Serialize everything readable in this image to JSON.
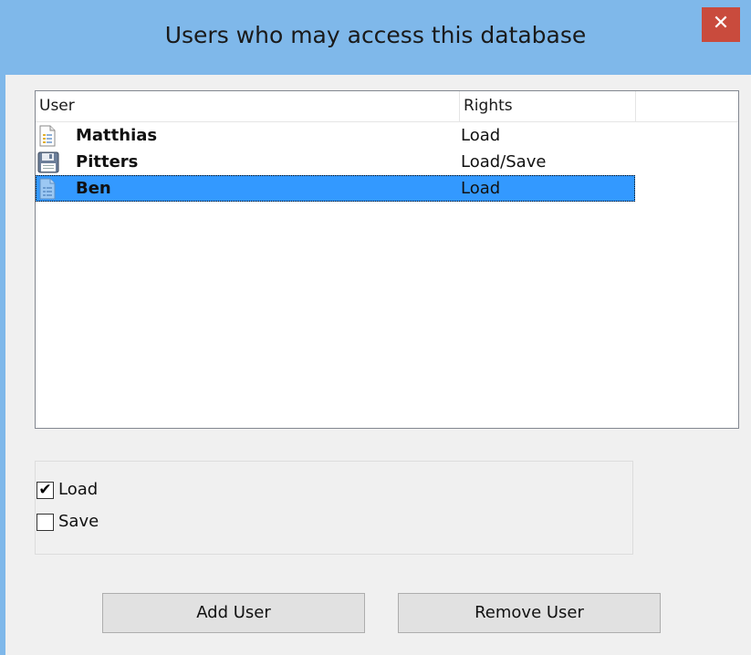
{
  "window": {
    "title": "Users who may access this database",
    "close_glyph": "✕"
  },
  "list": {
    "columns": [
      {
        "label": "User"
      },
      {
        "label": "Rights"
      },
      {
        "label": ""
      }
    ],
    "rows": [
      {
        "user": "Matthias",
        "rights": "Load",
        "icon": "document-icon",
        "selected": false
      },
      {
        "user": "Pitters",
        "rights": "Load/Save",
        "icon": "floppy-disk-icon",
        "selected": false
      },
      {
        "user": "Ben",
        "rights": "Load",
        "icon": "document-icon",
        "selected": true
      }
    ]
  },
  "rights_options": [
    {
      "label": "Load",
      "checked": true,
      "check_glyph": "✔"
    },
    {
      "label": "Save",
      "checked": false,
      "check_glyph": ""
    }
  ],
  "buttons": {
    "add_user": "Add User",
    "remove_user": "Remove User"
  },
  "colors": {
    "titlebar": "#7fb8ea",
    "close_button": "#c94b3d",
    "selection": "#3399ff"
  }
}
